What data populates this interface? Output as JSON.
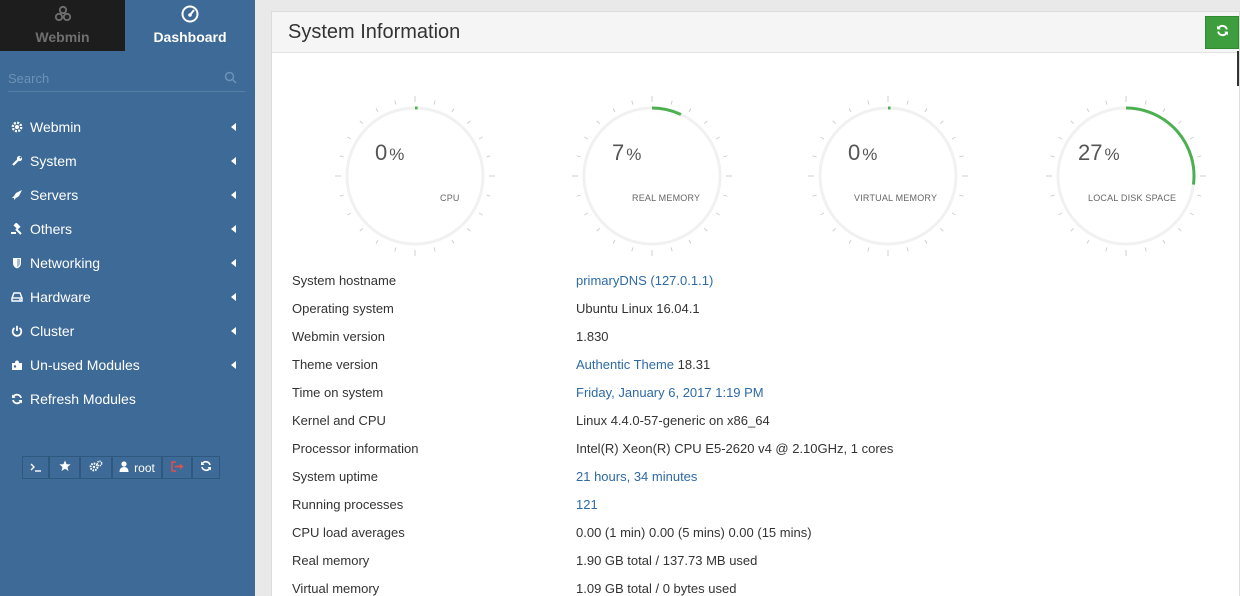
{
  "sidebar": {
    "tabs": [
      {
        "label": "Webmin",
        "icon": "webmin-logo-icon",
        "active": false
      },
      {
        "label": "Dashboard",
        "icon": "dashboard-gauge-icon",
        "active": true
      }
    ],
    "search": {
      "placeholder": "Search",
      "value": ""
    },
    "menu": [
      {
        "label": "Webmin",
        "icon": "gear-icon"
      },
      {
        "label": "System",
        "icon": "wrench-icon"
      },
      {
        "label": "Servers",
        "icon": "rocket-icon"
      },
      {
        "label": "Others",
        "icon": "gavel-icon"
      },
      {
        "label": "Networking",
        "icon": "shield-icon"
      },
      {
        "label": "Hardware",
        "icon": "hard-drive-icon"
      },
      {
        "label": "Cluster",
        "icon": "power-icon"
      },
      {
        "label": "Un-used Modules",
        "icon": "puzzle-icon"
      },
      {
        "label": "Refresh Modules",
        "icon": "refresh-icon"
      }
    ],
    "toolbar": {
      "user_label": "root",
      "buttons": [
        "terminal-icon",
        "star-icon",
        "cogs-icon",
        "user-icon",
        "logout-icon",
        "refresh-icon"
      ]
    }
  },
  "main": {
    "title": "System Information",
    "gauges": [
      {
        "value": "0",
        "unit": "%",
        "label": "CPU",
        "percent": 0
      },
      {
        "value": "7",
        "unit": "%",
        "label": "REAL MEMORY",
        "percent": 7
      },
      {
        "value": "0",
        "unit": "%",
        "label": "VIRTUAL MEMORY",
        "percent": 0
      },
      {
        "value": "27",
        "unit": "%",
        "label": "LOCAL DISK SPACE",
        "percent": 27
      }
    ],
    "info": [
      {
        "key": "System hostname",
        "value": "primaryDNS (127.0.1.1)",
        "link": true
      },
      {
        "key": "Operating system",
        "value": "Ubuntu Linux 16.04.1",
        "link": false
      },
      {
        "key": "Webmin version",
        "value": "1.830",
        "link": false
      },
      {
        "key": "Theme version",
        "value_link": "Authentic Theme",
        "value_rest": "18.31"
      },
      {
        "key": "Time on system",
        "value": "Friday, January 6, 2017 1:19 PM",
        "link": true
      },
      {
        "key": "Kernel and CPU",
        "value": "Linux 4.4.0-57-generic on x86_64",
        "link": false
      },
      {
        "key": "Processor information",
        "value": "Intel(R) Xeon(R) CPU E5-2620 v4 @ 2.10GHz, 1 cores",
        "link": false
      },
      {
        "key": "System uptime",
        "value": "21 hours, 34 minutes",
        "link": true
      },
      {
        "key": "Running processes",
        "value": "121",
        "link": true
      },
      {
        "key": "CPU load averages",
        "value": "0.00 (1 min) 0.00 (5 mins) 0.00 (15 mins)",
        "link": false
      },
      {
        "key": "Real memory",
        "value": "1.90 GB total / 137.73 MB used",
        "link": false
      },
      {
        "key": "Virtual memory",
        "value": "1.09 GB total / 0 bytes used",
        "link": false
      }
    ]
  },
  "colors": {
    "sidebar": "#3d6a96",
    "accent_green": "#4caf50",
    "link": "#2d6aa6",
    "refresh_button": "#3e9e3e"
  }
}
